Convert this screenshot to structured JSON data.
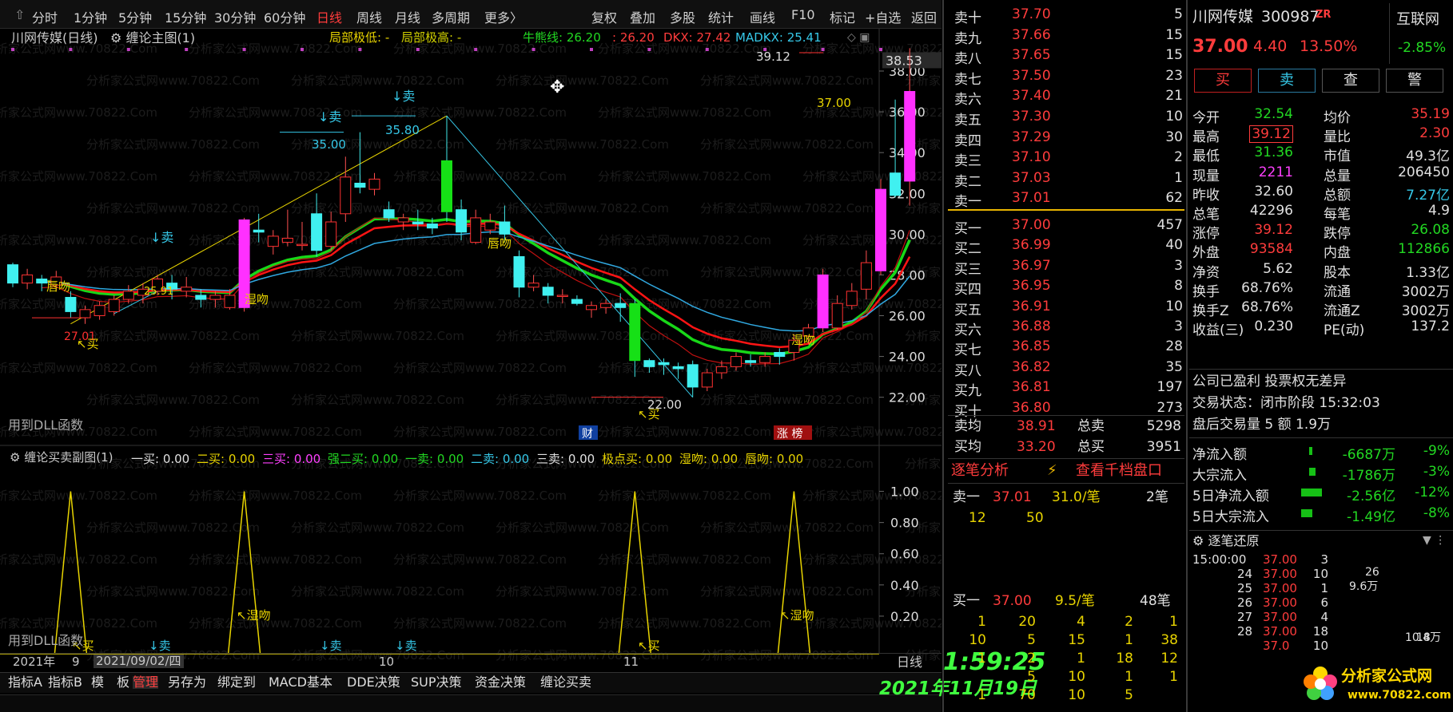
{
  "toolbar": {
    "periods": [
      "分时",
      "1分钟",
      "5分钟",
      "15分钟",
      "30分钟",
      "60分钟",
      "日线",
      "周线",
      "月线",
      "多周期",
      "更多〉"
    ],
    "active_period": "日线",
    "tools": [
      "复权",
      "叠加",
      "多股",
      "统计",
      "画线",
      "F10",
      "标记",
      "+自选",
      "返回"
    ]
  },
  "main_legend": {
    "title": "川网传媒(日线)",
    "indicator": "缠论主图(1)",
    "local_low": "局部极低: -",
    "local_high": "局部极高: -",
    "bull": "牛熊线: 26.20",
    "line2": ": 26.20",
    "dkx": "DKX: 27.42",
    "madkx": "MADKX: 25.41"
  },
  "chart_data": {
    "type": "candlestick",
    "ylim": [
      20.5,
      38.9
    ],
    "yticks": [
      "38.00",
      "36.00",
      "34.00",
      "32.00",
      "30.00",
      "28.00",
      "26.00",
      "24.00",
      "22.00"
    ],
    "price_tag": "38.53",
    "x_labels": [
      "2021年",
      "9",
      "2021/09/02/四",
      "10",
      "11"
    ],
    "candles": [
      [
        28.5,
        27.6,
        28.6,
        27.4
      ],
      [
        27.6,
        28.0,
        28.3,
        27.3
      ],
      [
        27.8,
        27.6,
        28.0,
        27.2
      ],
      [
        27.5,
        27.9,
        28.2,
        27.2
      ],
      [
        26.9,
        26.2,
        27.2,
        25.9
      ],
      [
        25.9,
        26.3,
        26.5,
        25.6
      ],
      [
        26.0,
        26.5,
        26.7,
        25.8
      ],
      [
        26.2,
        26.8,
        27.0,
        26.0
      ],
      [
        26.8,
        27.2,
        27.5,
        26.6
      ],
      [
        27.0,
        27.3,
        27.6,
        26.6
      ],
      [
        27.2,
        27.8,
        28.0,
        27.0
      ],
      [
        27.6,
        27.3,
        28.0,
        26.8
      ],
      [
        27.2,
        27.4,
        27.9,
        26.9
      ],
      [
        27.0,
        26.8,
        27.3,
        26.4
      ],
      [
        26.8,
        27.0,
        27.2,
        26.4
      ],
      [
        26.4,
        27.0,
        27.3,
        26.3
      ],
      [
        26.4,
        30.7,
        30.8,
        26.2
      ],
      [
        30.2,
        30.1,
        31.0,
        29.6
      ],
      [
        29.4,
        29.9,
        30.2,
        29.0
      ],
      [
        29.6,
        29.8,
        31.2,
        29.4
      ],
      [
        29.5,
        29.5,
        30.6,
        29.2
      ],
      [
        31.0,
        29.2,
        32.0,
        28.9
      ],
      [
        29.4,
        30.6,
        31.1,
        29.2
      ],
      [
        31.0,
        32.8,
        33.8,
        30.6
      ],
      [
        32.5,
        32.3,
        35.0,
        32.0
      ],
      [
        32.2,
        32.7,
        33.0,
        31.9
      ],
      [
        31.2,
        30.8,
        31.6,
        30.6
      ],
      [
        30.6,
        30.8,
        31.0,
        30.2
      ],
      [
        30.6,
        30.5,
        31.2,
        30.2
      ],
      [
        30.5,
        30.3,
        30.8,
        30.0
      ],
      [
        33.6,
        31.1,
        35.8,
        30.6
      ],
      [
        31.2,
        30.1,
        31.7,
        29.7
      ],
      [
        29.6,
        30.8,
        31.2,
        29.5
      ],
      [
        30.2,
        30.6,
        31.0,
        30.0
      ],
      [
        30.6,
        30.0,
        31.4,
        29.6
      ],
      [
        28.9,
        27.4,
        29.2,
        26.9
      ],
      [
        27.4,
        27.6,
        28.0,
        27.2
      ],
      [
        27.4,
        27.0,
        27.6,
        26.6
      ],
      [
        27.0,
        27.0,
        27.3,
        26.6
      ],
      [
        26.8,
        26.6,
        27.0,
        26.5
      ],
      [
        26.3,
        26.5,
        26.7,
        25.9
      ],
      [
        26.4,
        26.6,
        26.8,
        26.1
      ],
      [
        26.6,
        26.4,
        27.1,
        25.7
      ],
      [
        26.6,
        23.8,
        26.8,
        23.0
      ],
      [
        23.8,
        23.5,
        23.9,
        23.2
      ],
      [
        23.7,
        23.6,
        23.9,
        23.1
      ],
      [
        23.5,
        23.4,
        23.7,
        22.9
      ],
      [
        23.6,
        22.5,
        23.8,
        22.0
      ],
      [
        22.5,
        23.2,
        23.4,
        22.3
      ],
      [
        23.2,
        23.5,
        23.8,
        22.9
      ],
      [
        23.5,
        24.0,
        24.2,
        23.3
      ],
      [
        23.8,
        23.7,
        24.1,
        23.5
      ],
      [
        23.7,
        24.0,
        24.2,
        23.5
      ],
      [
        24.2,
        24.0,
        24.4,
        23.6
      ],
      [
        24.2,
        24.8,
        25.1,
        23.8
      ],
      [
        25.0,
        25.4,
        25.6,
        24.6
      ],
      [
        25.4,
        28.0,
        28.3,
        25.2
      ],
      [
        25.4,
        26.6,
        27.0,
        25.3
      ],
      [
        26.5,
        27.2,
        27.6,
        26.3
      ],
      [
        27.3,
        28.6,
        29.2,
        26.8
      ],
      [
        28.2,
        32.2,
        32.7,
        28.0
      ],
      [
        33.0,
        31.9,
        36.6,
        31.8
      ],
      [
        32.6,
        37.0,
        39.12,
        31.4
      ]
    ],
    "annotations": [
      "↓卖",
      "35.00",
      "↓卖",
      "35.80",
      "↓卖",
      "25.91",
      "27.01",
      "39.12",
      "37.00",
      "22.00",
      "唇吻",
      "唇吻",
      "湿吻",
      "湿吻",
      "买",
      "买",
      "财",
      "涨 榜"
    ],
    "overlays": [
      {
        "name": "牛熊线",
        "color": "#18d818"
      },
      {
        "name": "DKX",
        "color": "#ff1414"
      },
      {
        "name": "MADKX",
        "color": "#30a8e0"
      }
    ],
    "sub_chart": {
      "title": "缠论买卖副图(1)",
      "ylim": [
        0,
        1.1
      ],
      "yticks": [
        "1.00",
        "0.80",
        "0.60",
        "0.40",
        "0.20"
      ],
      "signals": [
        {
          "name": "一买",
          "value": "0.00",
          "color": "#e0e0e0"
        },
        {
          "name": "二买",
          "value": "0.00",
          "color": "#e8d400"
        },
        {
          "name": "三买",
          "value": "0.00",
          "color": "#ff40ff"
        },
        {
          "name": "强二买",
          "value": "0.00",
          "color": "#22d822"
        },
        {
          "name": "一卖",
          "value": "0.00",
          "color": "#22d822"
        },
        {
          "name": "二卖",
          "value": "0.00",
          "color": "#36c8e8"
        },
        {
          "name": "三卖",
          "value": "0.00",
          "color": "#e0e0e0"
        },
        {
          "name": "极点买",
          "value": "0.00",
          "color": "#e8d400"
        },
        {
          "name": "湿吻",
          "value": "0.00",
          "color": "#e8d400"
        },
        {
          "name": "唇吻",
          "value": "0.00",
          "color": "#e8d400"
        }
      ],
      "peaks_at": [
        4,
        16,
        43,
        54
      ],
      "labels": [
        "湿吻",
        "湿吻",
        "买",
        "买",
        "↓卖",
        "↓卖",
        "↓卖"
      ]
    },
    "dll_note": "用到DLL函数"
  },
  "bottom": {
    "period": "日线",
    "tabs": [
      "指标A",
      "指标B",
      "模",
      "板",
      "管理",
      "另存为",
      "绑定到",
      "MACD基本",
      "DDE决策",
      "SUP决策",
      "资金决策",
      "缠论买卖"
    ],
    "active_tab": "管理",
    "time": "1:59:25",
    "date": "2021年11月19日"
  },
  "orderbook": {
    "asks": [
      {
        "label": "卖十",
        "price": "37.70",
        "vol": "5"
      },
      {
        "label": "卖九",
        "price": "37.66",
        "vol": "15"
      },
      {
        "label": "卖八",
        "price": "37.65",
        "vol": "15"
      },
      {
        "label": "卖七",
        "price": "37.50",
        "vol": "23"
      },
      {
        "label": "卖六",
        "price": "37.40",
        "vol": "21"
      },
      {
        "label": "卖五",
        "price": "37.30",
        "vol": "10"
      },
      {
        "label": "卖四",
        "price": "37.29",
        "vol": "30"
      },
      {
        "label": "卖三",
        "price": "37.10",
        "vol": "2"
      },
      {
        "label": "卖二",
        "price": "37.03",
        "vol": "1"
      },
      {
        "label": "卖一",
        "price": "37.01",
        "vol": "62"
      }
    ],
    "bids": [
      {
        "label": "买一",
        "price": "37.00",
        "vol": "457"
      },
      {
        "label": "买二",
        "price": "36.99",
        "vol": "40"
      },
      {
        "label": "买三",
        "price": "36.97",
        "vol": "3"
      },
      {
        "label": "买四",
        "price": "36.95",
        "vol": "8"
      },
      {
        "label": "买五",
        "price": "36.91",
        "vol": "10"
      },
      {
        "label": "买六",
        "price": "36.88",
        "vol": "3"
      },
      {
        "label": "买七",
        "price": "36.85",
        "vol": "28"
      },
      {
        "label": "买八",
        "price": "36.82",
        "vol": "35"
      },
      {
        "label": "买九",
        "price": "36.81",
        "vol": "197"
      },
      {
        "label": "买十",
        "price": "36.80",
        "vol": "273"
      }
    ],
    "avg_ask_label": "卖均",
    "avg_ask": "38.91",
    "total_ask_label": "总卖",
    "total_ask": "5298",
    "avg_bid_label": "买均",
    "avg_bid": "33.20",
    "total_bid_label": "总买",
    "total_bid": "3951"
  },
  "tick_panel": {
    "tab1": "逐笔分析",
    "tab2": "查看千档盘口",
    "sell_label": "卖一",
    "sell_price": "37.01",
    "sell_avg": "31.0/笔",
    "sell_count": "2笔",
    "sell_q": [
      "12",
      "50"
    ],
    "buy_label": "买一",
    "buy_price": "37.00",
    "buy_avg": "9.5/笔",
    "buy_count": "48笔",
    "buy_q": [
      [
        "1",
        "20",
        "4",
        "2",
        "1"
      ],
      [
        "10",
        "5",
        "15",
        "1",
        "38"
      ],
      [
        "1",
        "2",
        "1",
        "18",
        "12"
      ],
      [
        "",
        "5",
        "10",
        "1",
        "1"
      ],
      [
        "1",
        "70",
        "10",
        "5"
      ]
    ]
  },
  "quote": {
    "name": "川网传媒",
    "code": "300987",
    "tag": "ZR",
    "price": "37.00",
    "change": "4.40",
    "pct": "13.50%",
    "idx_name": "互联网",
    "idx_pct": "-2.85%",
    "buttons": [
      "买",
      "卖",
      "查",
      "警"
    ],
    "rows": [
      [
        "今开",
        "32.54",
        "均价",
        "35.19"
      ],
      [
        "最高",
        "39.12",
        "量比",
        "2.30"
      ],
      [
        "最低",
        "31.36",
        "市值",
        "49.3亿"
      ],
      [
        "现量",
        "2211",
        "总量",
        "206450"
      ],
      [
        "昨收",
        "32.60",
        "总额",
        "7.27亿"
      ],
      [
        "总笔",
        "42296",
        "每笔",
        "4.9"
      ],
      [
        "涨停",
        "39.12",
        "跌停",
        "26.08"
      ],
      [
        "外盘",
        "93584",
        "内盘",
        "112866"
      ],
      [
        "净资",
        "5.62",
        "股本",
        "1.33亿"
      ],
      [
        "换手",
        "68.76%",
        "流通",
        "3002万"
      ],
      [
        "换手Z",
        "68.76%",
        "流通Z",
        "3002万"
      ],
      [
        "收益(三)",
        "0.230",
        "PE(动)",
        "137.2"
      ]
    ],
    "profit": "公司已盈利  投票权无差异",
    "status": "交易状态：闭市阶段 15:32:03",
    "after": "盘后交易量 5 额 1.9万",
    "flows": [
      [
        "净流入额",
        "-6687万",
        "-9%"
      ],
      [
        "大宗流入",
        "-1786万",
        "-3%"
      ],
      [
        "5日净流入额",
        "-2.56亿",
        "-12%"
      ],
      [
        "5日大宗流入",
        "-1.49亿",
        "-8%"
      ]
    ],
    "trades_title": "逐笔还原",
    "trades_time": "15:00:00",
    "trades": [
      [
        "37.00",
        "3"
      ],
      [
        "37.00",
        "10"
      ],
      [
        "37.00",
        "1"
      ],
      [
        "37.00",
        "6"
      ],
      [
        "37.00",
        "4"
      ],
      [
        "37.00",
        "18"
      ],
      [
        "37.0",
        "10"
      ]
    ],
    "trades_min": [
      "",
      "24",
      "25",
      "26",
      "27",
      "28",
      ""
    ],
    "trade_side": [
      "26",
      "9.6万",
      "18",
      "10.4万"
    ]
  },
  "watermark": "分析家公式网www.70822.Com",
  "logo": {
    "brand": "分析家公式网",
    "url": "www.70822.com"
  }
}
